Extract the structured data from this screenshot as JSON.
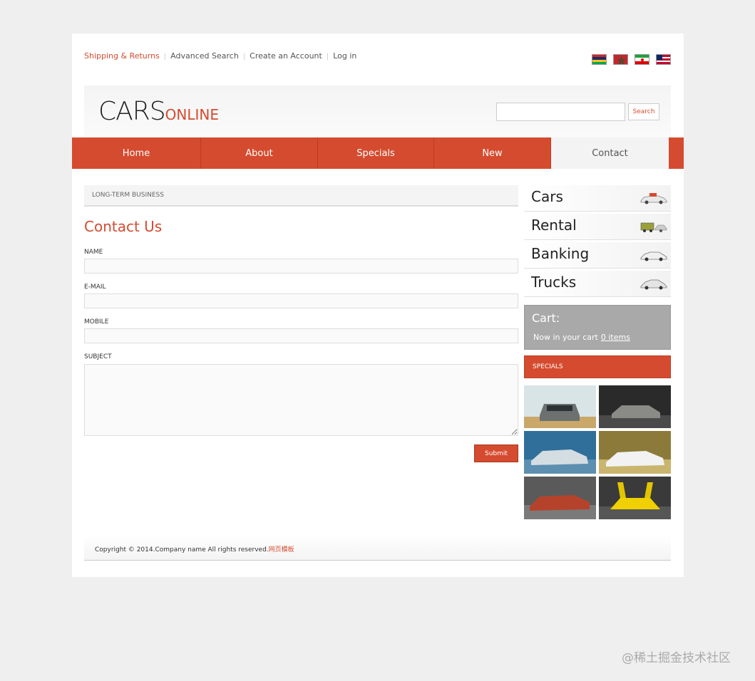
{
  "toplinks": [
    "Shipping & Returns",
    "Advanced Search",
    "Create an Account",
    "Log in"
  ],
  "flags": [
    {
      "name": "flag-mauritius",
      "colors": [
        "#d2232a",
        "#1a2b6d",
        "#f5c518",
        "#00a651"
      ]
    },
    {
      "name": "flag-morocco",
      "colors": [
        "#c1272d",
        "#c1272d",
        "#c1272d"
      ]
    },
    {
      "name": "flag-iran",
      "colors": [
        "#239f40",
        "#ffffff",
        "#da0000"
      ]
    },
    {
      "name": "flag-liberia",
      "colors": [
        "#bf0a30",
        "#ffffff",
        "#bf0a30",
        "#ffffff",
        "#bf0a30"
      ]
    }
  ],
  "logo": {
    "main": "CARS",
    "sub": "ONLINE"
  },
  "search": {
    "button": "Search",
    "placeholder": ""
  },
  "nav": [
    "Home",
    "About",
    "Specials",
    "New",
    "Contact"
  ],
  "breadcrumb": "LONG-TERM BUSINESS",
  "contact": {
    "title": "Contact Us",
    "fields": {
      "name": "NAME",
      "email": "E-MAIL",
      "mobile": "MOBILE",
      "subject": "SUBJECT"
    },
    "submit": "Submit"
  },
  "categories": [
    "Cars",
    "Rental",
    "Banking",
    "Trucks"
  ],
  "cart": {
    "title": "Cart:",
    "text": "Now in your cart",
    "items": "0 items"
  },
  "specials": "SPECIALS",
  "footer": {
    "text": "Copyright © 2014.Company name All rights reserved.",
    "link": "网页模板"
  },
  "watermark": "@稀土掘金技术社区",
  "colors": {
    "accent": "#d54b2f",
    "cart": "#a9a9a9"
  }
}
